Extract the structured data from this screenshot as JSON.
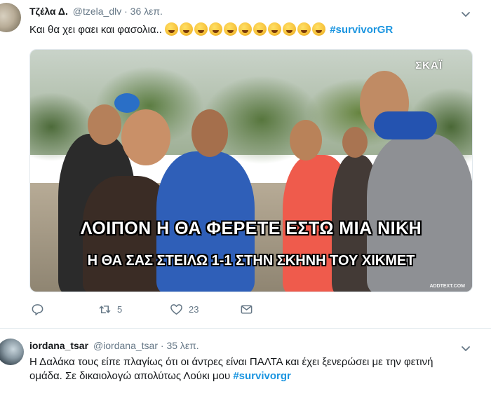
{
  "tweets": [
    {
      "name": "Τζέλα Δ.",
      "handle": "@tzela_dlv",
      "separator": "·",
      "time": "36 λεπ.",
      "text": "Και θα χει φαει και φασολια..",
      "hashtag": "#survivorGR",
      "media": {
        "logo": "ΣΚΑΪ",
        "caption_line1": "ΛΟΙΠΟΝ Η ΘΑ ΦΕΡΕΤΕ ΕΣΤΩ ΜΙΑ ΝΙΚΗ",
        "caption_line2": "Η ΘΑ ΣΑΣ ΣΤΕΙΛΩ 1-1 ΣΤΗΝ ΣΚΗΝΗ ΤΟΥ ΧΙΚΜΕΤ",
        "watermark": "ADDTEXT.COM"
      },
      "actions": {
        "reply_count": "",
        "retweet_count": "5",
        "like_count": "23"
      }
    },
    {
      "name": "iordana_tsar",
      "handle": "@iordana_tsar",
      "separator": "·",
      "time": "35 λεπ.",
      "text": "Η Δαλάκα τους είπε πλαγίως ότι οι άντρες είναι ΠΑΛΤΑ και έχει ξενερώσει με την φετινή ομάδα. Σε δικαιολογώ απολύτως Λούκι μου",
      "hashtag": "#survivorgr"
    }
  ],
  "colors": {
    "hashtag": "#1b95e0",
    "secondary_text": "#657786",
    "primary_text": "#14171a"
  }
}
